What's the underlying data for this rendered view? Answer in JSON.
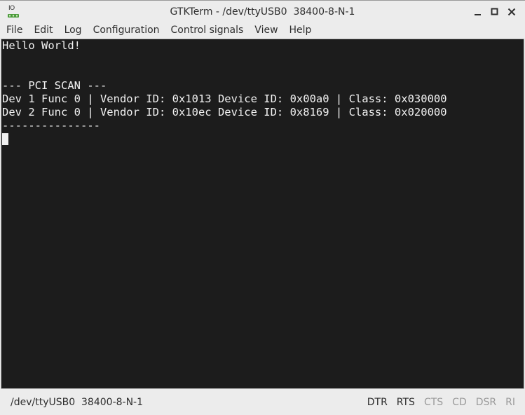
{
  "window": {
    "title": "GTKTerm - /dev/ttyUSB0  38400-8-N-1",
    "icon_label": "IO",
    "controls": [
      "minimize-icon",
      "maximize-icon",
      "close-icon"
    ]
  },
  "menu": {
    "items": [
      "File",
      "Edit",
      "Log",
      "Configuration",
      "Control signals",
      "View",
      "Help"
    ]
  },
  "terminal": {
    "lines": [
      "Hello World!",
      "",
      "",
      "--- PCI SCAN ---",
      "Dev 1 Func 0 | Vendor ID: 0x1013 Device ID: 0x00a0 | Class: 0x030000",
      "Dev 2 Func 0 | Vendor ID: 0x10ec Device ID: 0x8169 | Class: 0x020000",
      "---------------"
    ],
    "background": "#1c1c1c",
    "foreground": "#f2f2f2"
  },
  "status": {
    "port": "/dev/ttyUSB0  38400-8-N-1",
    "signals": [
      {
        "label": "DTR",
        "active": true
      },
      {
        "label": "RTS",
        "active": true
      },
      {
        "label": "CTS",
        "active": false
      },
      {
        "label": "CD",
        "active": false
      },
      {
        "label": "DSR",
        "active": false
      },
      {
        "label": "RI",
        "active": false
      }
    ]
  }
}
